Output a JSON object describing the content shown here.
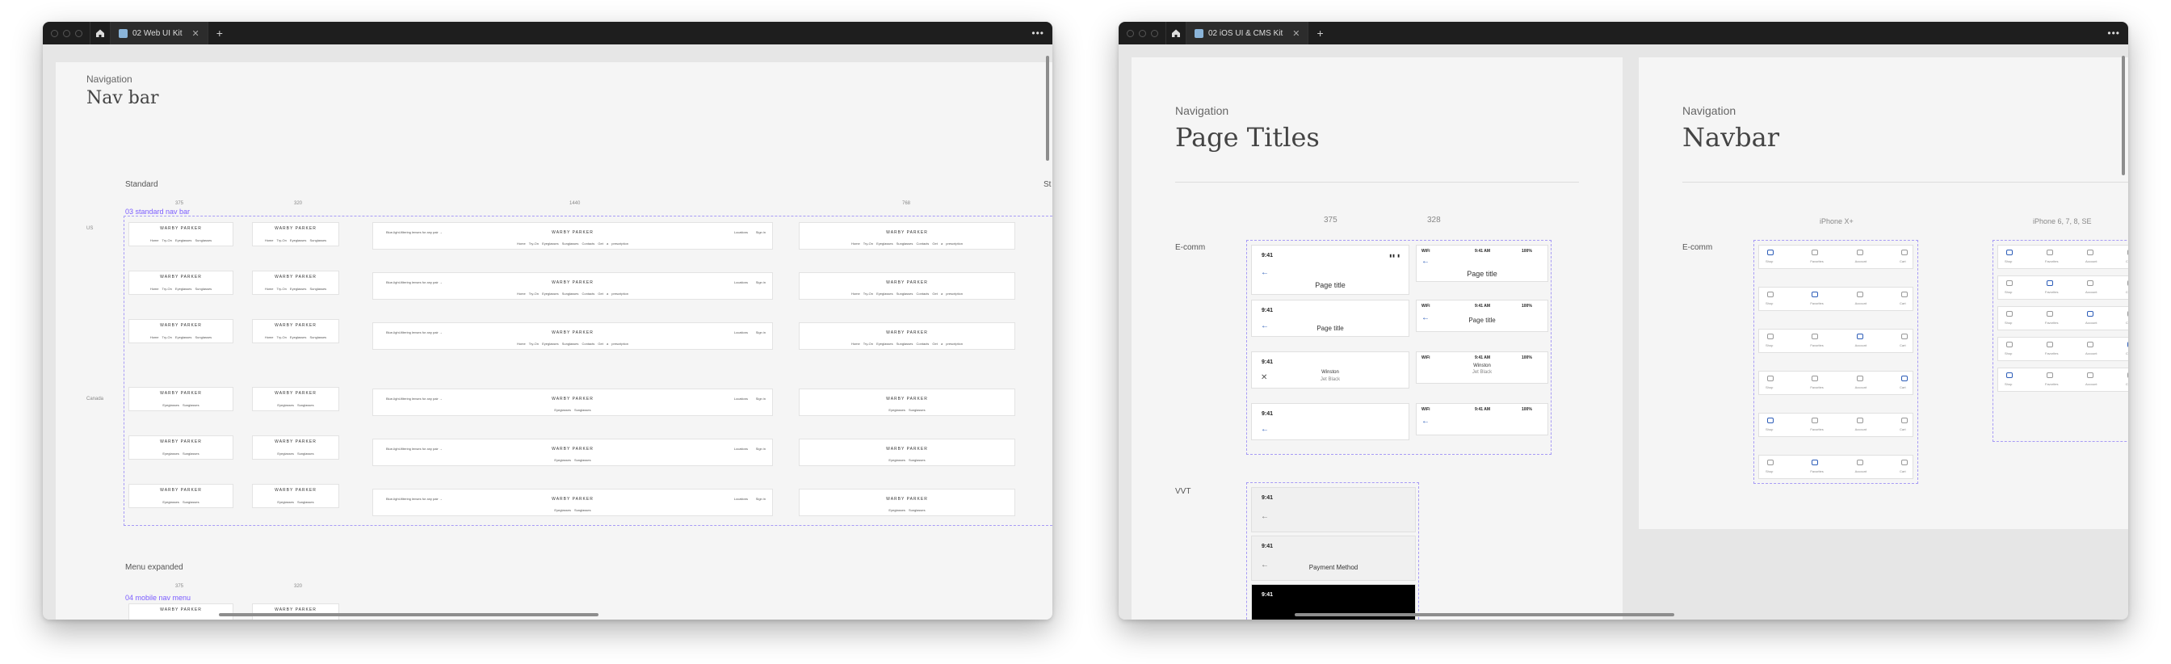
{
  "window1": {
    "tab": "02 Web UI Kit",
    "section": "Navigation",
    "title": "Nav bar",
    "standard": "Standard",
    "standard_cut": "St",
    "component": "03 standard nav bar",
    "widths": [
      "375",
      "320",
      "1440",
      "768"
    ],
    "rows": [
      "US",
      "Canada"
    ],
    "brand": "WARBY PARKER",
    "us_links": "Home Try-On  Eyeglasses  Sunglasses",
    "ca_links": "Eyeglasses  Sunglasses",
    "desk_links": "Home Try-On  Eyeglasses  Sunglasses  Contacts  Get a prescription",
    "promo": "Blue-light-filtering lenses for any pair →",
    "loc": "Locations",
    "sign": "Sign in",
    "menu": "Menu expanded",
    "menu_component": "04 mobile nav menu",
    "menu_widths": [
      "375",
      "320"
    ]
  },
  "window2": {
    "tab": "02 iOS UI & CMS Kit",
    "left": {
      "section": "Navigation",
      "title": "Page Titles",
      "widths": [
        "375",
        "328"
      ],
      "ecomm": "E-comm",
      "vvt": "VVT",
      "time": "9:41",
      "time2": "9:41 AM",
      "wifi": "WiFi",
      "battery": "100%",
      "pagetitle": "Page title",
      "winston": "Winston",
      "color": "Jet Black",
      "payment": "Payment Method"
    },
    "right": {
      "section": "Navigation",
      "title": "Navbar",
      "devices": [
        "iPhone X+",
        "iPhone 6, 7, 8, SE"
      ],
      "ecomm": "E-comm",
      "tabs": [
        "Shop",
        "Favorites",
        "Account",
        "Cart"
      ]
    }
  }
}
